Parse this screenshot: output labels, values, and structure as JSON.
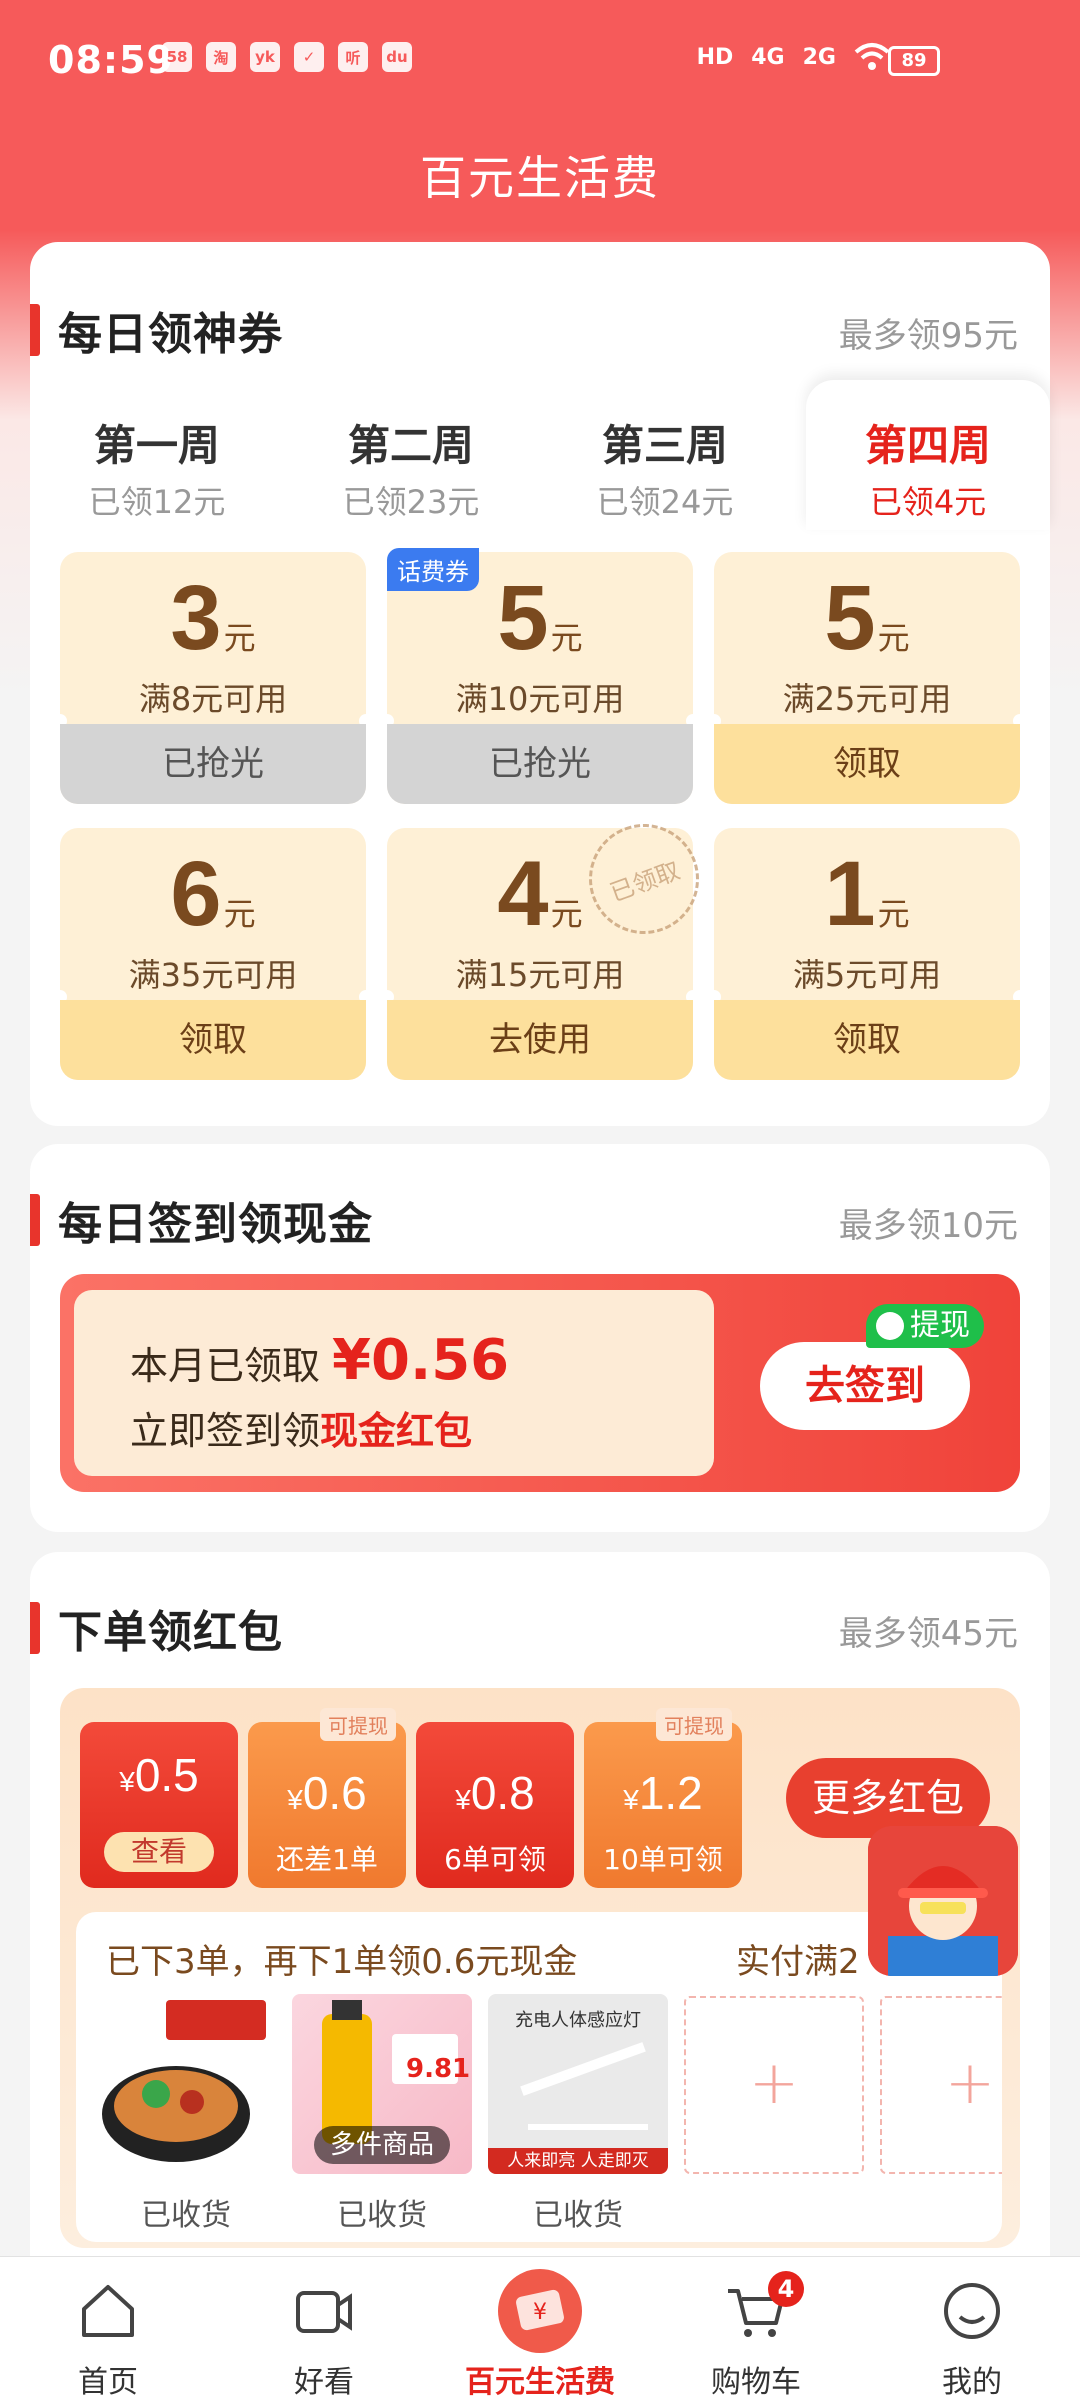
{
  "status": {
    "time": "08:59",
    "apps": [
      "58",
      "淘",
      "yk",
      "✓",
      "听",
      "du"
    ],
    "network": [
      "HD",
      "4G",
      "2G"
    ],
    "battery": "89"
  },
  "title": "百元生活费",
  "daily_coupons": {
    "title": "每日领神券",
    "max": "最多领95元",
    "weeks": [
      {
        "name": "第一周",
        "claimed": "已领12元"
      },
      {
        "name": "第二周",
        "claimed": "已领23元"
      },
      {
        "name": "第三周",
        "claimed": "已领24元"
      },
      {
        "name": "第四周",
        "claimed": "已领4元",
        "active": true
      }
    ],
    "coupons": [
      {
        "amount": "3",
        "unit": "元",
        "condition": "满8元可用",
        "action": "已抢光",
        "state": "gone"
      },
      {
        "amount": "5",
        "unit": "元",
        "condition": "满10元可用",
        "action": "已抢光",
        "state": "gone",
        "badge": "话费券"
      },
      {
        "amount": "5",
        "unit": "元",
        "condition": "满25元可用",
        "action": "领取",
        "state": "available"
      },
      {
        "amount": "6",
        "unit": "元",
        "condition": "满35元可用",
        "action": "领取",
        "state": "available"
      },
      {
        "amount": "4",
        "unit": "元",
        "condition": "满15元可用",
        "action": "去使用",
        "state": "claimed",
        "stamp": "已领取"
      },
      {
        "amount": "1",
        "unit": "元",
        "condition": "满5元可用",
        "action": "领取",
        "state": "available"
      }
    ]
  },
  "sign_in": {
    "title": "每日签到领现金",
    "max": "最多领10元",
    "month_label": "本月已领取",
    "month_amount": "¥0.56",
    "cta_prefix": "立即签到领",
    "cta_highlight": "现金红包",
    "button": "去签到",
    "withdraw_tag": "提现"
  },
  "order_packets": {
    "title": "下单领红包",
    "max": "最多领45元",
    "packets": [
      {
        "value": "0.5",
        "label": "查看",
        "style": "red"
      },
      {
        "value": "0.6",
        "label": "还差1单",
        "style": "orange",
        "tag": "可提现"
      },
      {
        "value": "0.8",
        "label": "6单可领",
        "style": "red2"
      },
      {
        "value": "1.2",
        "label": "10单可领",
        "style": "orange",
        "tag": "可提现"
      }
    ],
    "currency": "¥",
    "more_button": "更多红包",
    "progress_text": "已下3单，再下1单领0.6元现金",
    "progress_text2": "实付满2",
    "products": [
      {
        "label": "已收货",
        "overlay": ""
      },
      {
        "label": "已收货",
        "overlay": "多件商品",
        "price": "9.81"
      },
      {
        "label": "已收货",
        "overlay": "",
        "caption": "充电人体感应灯",
        "footer": "人来即亮 人走即灭"
      }
    ],
    "add_slots": [
      "+",
      "+"
    ]
  },
  "bottom_nav": [
    {
      "label": "首页",
      "icon": "home-icon"
    },
    {
      "label": "好看",
      "icon": "video-icon"
    },
    {
      "label": "百元生活费",
      "icon": "living-fee-icon",
      "active": true
    },
    {
      "label": "购物车",
      "icon": "cart-icon",
      "badge": "4"
    },
    {
      "label": "我的",
      "icon": "profile-icon"
    }
  ],
  "colors": {
    "accent": "#e5231c",
    "header": "#f65a5a",
    "coupon_bg": "#fef0d6",
    "coupon_btn": "#fde09c"
  }
}
